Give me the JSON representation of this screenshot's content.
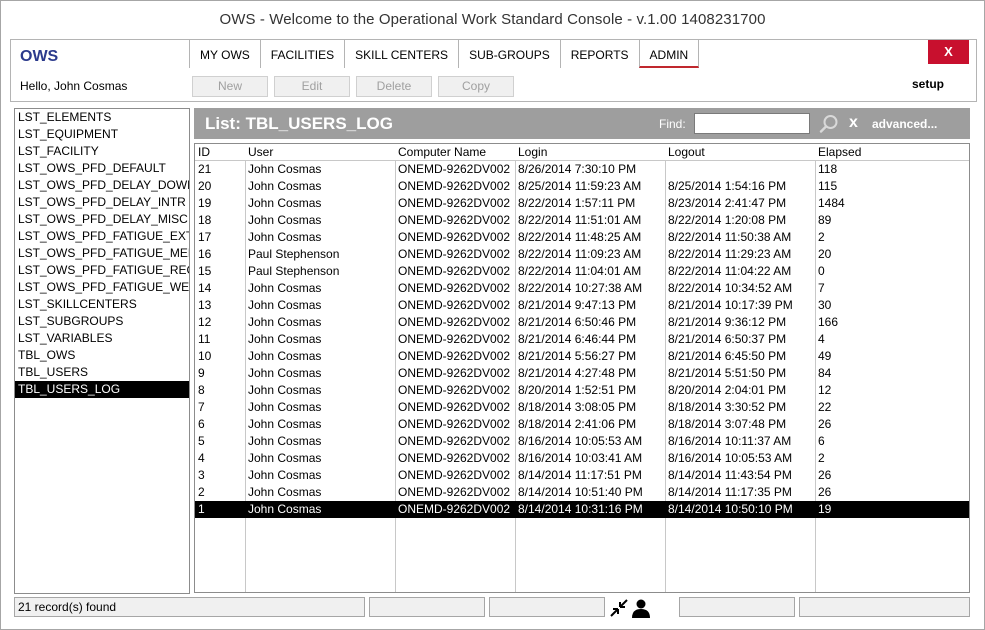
{
  "window": {
    "title": "OWS - Welcome to the Operational Work Standard Console - v.1.00 1408231700"
  },
  "header": {
    "logo": "OWS",
    "greeting": "Hello, John Cosmas",
    "close_label": "X",
    "setup_label": "setup",
    "nav": [
      "MY OWS",
      "FACILITIES",
      "SKILL CENTERS",
      "SUB-GROUPS",
      "REPORTS",
      "ADMIN"
    ],
    "active_nav": "ADMIN",
    "toolbar": {
      "new": "New",
      "edit": "Edit",
      "delete": "Delete",
      "copy": "Copy"
    }
  },
  "sidebar": {
    "items": [
      "LST_ELEMENTS",
      "LST_EQUIPMENT",
      "LST_FACILITY",
      "LST_OWS_PFD_DEFAULT",
      "LST_OWS_PFD_DELAY_DOWN",
      "LST_OWS_PFD_DELAY_INTR",
      "LST_OWS_PFD_DELAY_MISC",
      "LST_OWS_PFD_FATIGUE_EXT",
      "LST_OWS_PFD_FATIGUE_MEN",
      "LST_OWS_PFD_FATIGUE_REC",
      "LST_OWS_PFD_FATIGUE_WE",
      "LST_SKILLCENTERS",
      "LST_SUBGROUPS",
      "LST_VARIABLES",
      "TBL_OWS",
      "TBL_USERS",
      "TBL_USERS_LOG"
    ],
    "selected": "TBL_USERS_LOG"
  },
  "list": {
    "title": "List: TBL_USERS_LOG",
    "find_label": "Find:",
    "find_value": "",
    "clear_label": "x",
    "advanced_label": "advanced...",
    "columns": [
      "ID",
      "User",
      "Computer Name",
      "Login",
      "Logout",
      "Elapsed"
    ],
    "rows": [
      [
        "21",
        "John Cosmas",
        "ONEMD-9262DV002",
        "8/26/2014 7:30:10 PM",
        "",
        "118"
      ],
      [
        "20",
        "John Cosmas",
        "ONEMD-9262DV002",
        "8/25/2014 11:59:23 AM",
        "8/25/2014 1:54:16 PM",
        "115"
      ],
      [
        "19",
        "John Cosmas",
        "ONEMD-9262DV002",
        "8/22/2014 1:57:11 PM",
        "8/23/2014 2:41:47 PM",
        "1484"
      ],
      [
        "18",
        "John Cosmas",
        "ONEMD-9262DV002",
        "8/22/2014 11:51:01 AM",
        "8/22/2014 1:20:08 PM",
        "89"
      ],
      [
        "17",
        "John Cosmas",
        "ONEMD-9262DV002",
        "8/22/2014 11:48:25 AM",
        "8/22/2014 11:50:38 AM",
        "2"
      ],
      [
        "16",
        "Paul Stephenson",
        "ONEMD-9262DV002",
        "8/22/2014 11:09:23 AM",
        "8/22/2014 11:29:23 AM",
        "20"
      ],
      [
        "15",
        "Paul Stephenson",
        "ONEMD-9262DV002",
        "8/22/2014 11:04:01 AM",
        "8/22/2014 11:04:22 AM",
        "0"
      ],
      [
        "14",
        "John Cosmas",
        "ONEMD-9262DV002",
        "8/22/2014 10:27:38 AM",
        "8/22/2014 10:34:52 AM",
        "7"
      ],
      [
        "13",
        "John Cosmas",
        "ONEMD-9262DV002",
        "8/21/2014 9:47:13 PM",
        "8/21/2014 10:17:39 PM",
        "30"
      ],
      [
        "12",
        "John Cosmas",
        "ONEMD-9262DV002",
        "8/21/2014 6:50:46 PM",
        "8/21/2014 9:36:12 PM",
        "166"
      ],
      [
        "11",
        "John Cosmas",
        "ONEMD-9262DV002",
        "8/21/2014 6:46:44 PM",
        "8/21/2014 6:50:37 PM",
        "4"
      ],
      [
        "10",
        "John Cosmas",
        "ONEMD-9262DV002",
        "8/21/2014 5:56:27 PM",
        "8/21/2014 6:45:50 PM",
        "49"
      ],
      [
        "9",
        "John Cosmas",
        "ONEMD-9262DV002",
        "8/21/2014 4:27:48 PM",
        "8/21/2014 5:51:50 PM",
        "84"
      ],
      [
        "8",
        "John Cosmas",
        "ONEMD-9262DV002",
        "8/20/2014 1:52:51 PM",
        "8/20/2014 2:04:01 PM",
        "12"
      ],
      [
        "7",
        "John Cosmas",
        "ONEMD-9262DV002",
        "8/18/2014 3:08:05 PM",
        "8/18/2014 3:30:52 PM",
        "22"
      ],
      [
        "6",
        "John Cosmas",
        "ONEMD-9262DV002",
        "8/18/2014 2:41:06 PM",
        "8/18/2014 3:07:48 PM",
        "26"
      ],
      [
        "5",
        "John Cosmas",
        "ONEMD-9262DV002",
        "8/16/2014 10:05:53 AM",
        "8/16/2014 10:11:37 AM",
        "6"
      ],
      [
        "4",
        "John Cosmas",
        "ONEMD-9262DV002",
        "8/16/2014 10:03:41 AM",
        "8/16/2014 10:05:53 AM",
        "2"
      ],
      [
        "3",
        "John Cosmas",
        "ONEMD-9262DV002",
        "8/14/2014 11:17:51 PM",
        "8/14/2014 11:43:54 PM",
        "26"
      ],
      [
        "2",
        "John Cosmas",
        "ONEMD-9262DV002",
        "8/14/2014 10:51:40 PM",
        "8/14/2014 11:17:35 PM",
        "26"
      ],
      [
        "1",
        "John Cosmas",
        "ONEMD-9262DV002",
        "8/14/2014 10:31:16 PM",
        "8/14/2014 10:50:10 PM",
        "19"
      ]
    ],
    "selected_id": "1"
  },
  "status": {
    "record_count": "21 record(s) found",
    "icons": [
      "collapse-arrows-icon",
      "user-icon"
    ]
  },
  "colors": {
    "close_button": "#c8102e",
    "logo": "#2b3a8c",
    "list_header": "#9e9e9e",
    "selection": "#000000",
    "active_tab_underline": "#c0282e"
  }
}
